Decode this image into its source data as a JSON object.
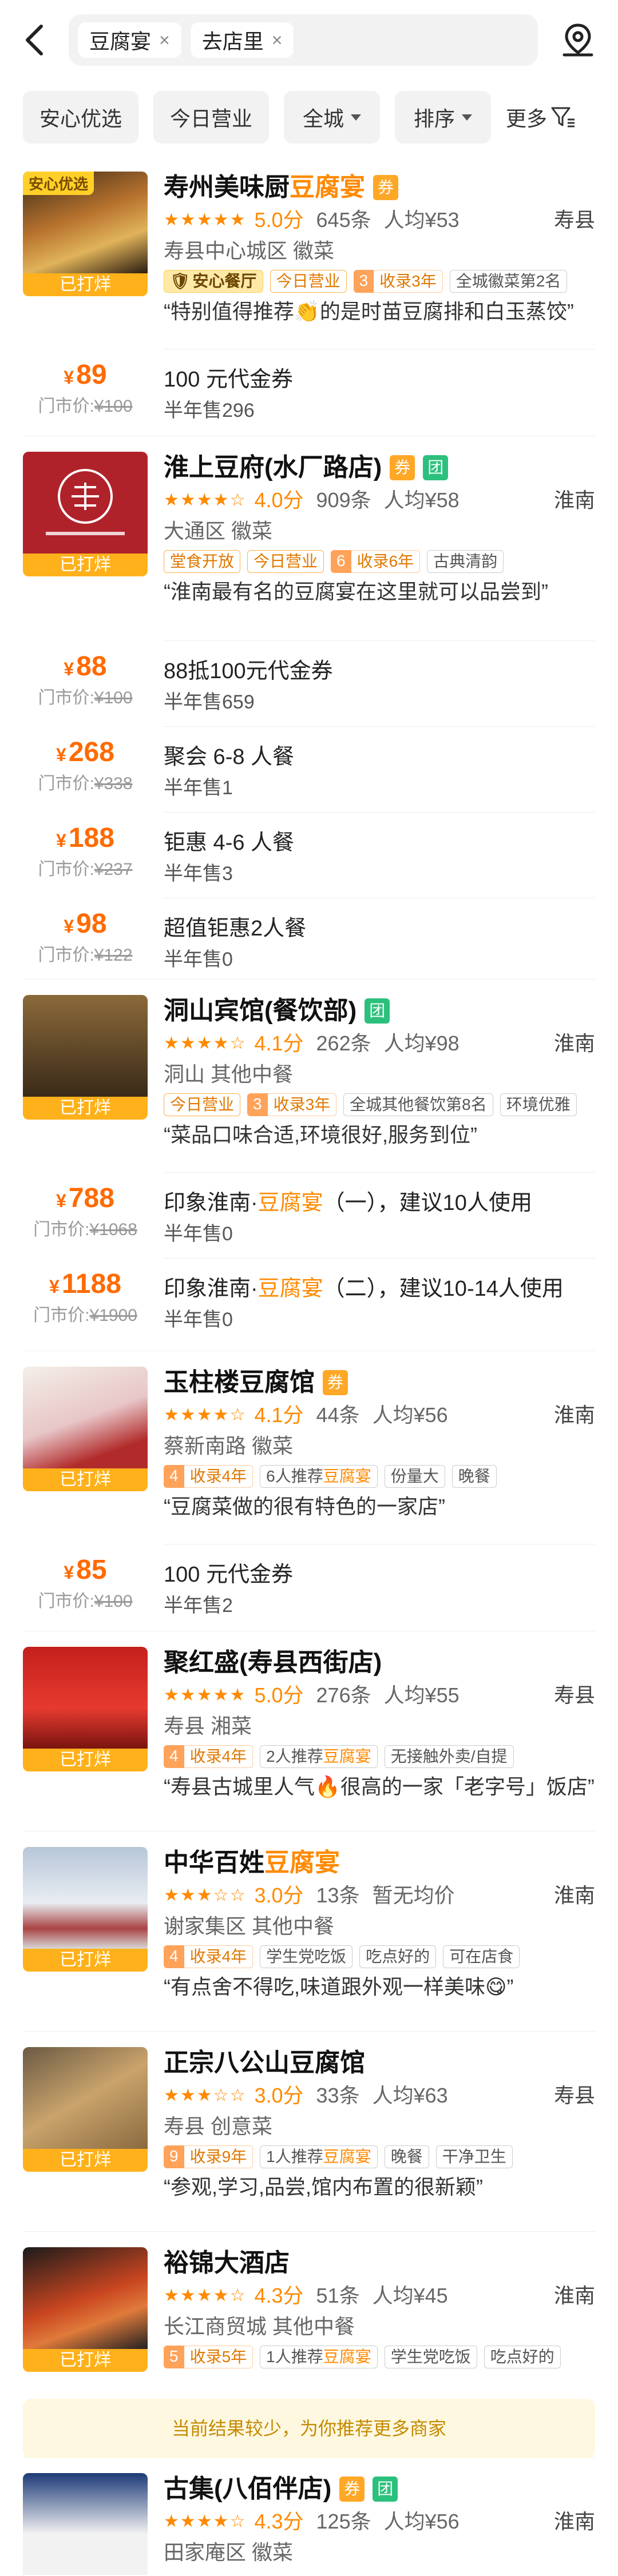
{
  "search": {
    "chips": [
      "豆腐宴",
      "去店里"
    ],
    "clear_glyph": "×"
  },
  "filters": [
    "安心优选",
    "今日营业",
    "全城",
    "排序"
  ],
  "more_label": "更多",
  "shops": [
    {
      "name_pre": "寿州美味厨",
      "name_hl": "豆腐宴",
      "name_post": "",
      "quan": "券",
      "tuan": "",
      "stars": "★★★★★",
      "score": "5.0分",
      "reviews": "645条",
      "avg": "人均¥53",
      "city": "寿县",
      "area": "寿县中心城区  徽菜",
      "badge": "安心优选",
      "tags": [
        {
          "type": "safe",
          "text": "安心餐厅"
        },
        {
          "type": "org",
          "text": "今日营业"
        },
        {
          "type": "rank",
          "n": "3",
          "l": "收录3年"
        },
        {
          "type": "plain",
          "text": "全城徽菜第2名"
        }
      ],
      "quote": "“特别值得推荐👏的是时苗豆腐排和白玉蒸饺”",
      "bar": "已打烊",
      "deals": [
        {
          "price": "89",
          "orig": "¥100",
          "title": "100 元代金券",
          "sold": "半年售296"
        }
      ]
    },
    {
      "name_pre": "淮上豆府(水厂路店)",
      "name_hl": "",
      "name_post": "",
      "quan": "券",
      "tuan": "团",
      "stars": "★★★★☆",
      "score": "4.0分",
      "reviews": "909条",
      "avg": "人均¥58",
      "city": "淮南",
      "area": "大通区  徽菜",
      "badge": "",
      "tags": [
        {
          "type": "org",
          "text": "堂食开放"
        },
        {
          "type": "org",
          "text": "今日营业"
        },
        {
          "type": "rank",
          "n": "6",
          "l": "收录6年"
        },
        {
          "type": "plain",
          "text": "古典清韵"
        }
      ],
      "quote": "“淮南最有名的豆腐宴在这里就可以品尝到”",
      "bar": "已打烊",
      "deals": [
        {
          "price": "88",
          "orig": "¥100",
          "title": "88抵100元代金券",
          "sold": "半年售659"
        },
        {
          "price": "268",
          "orig": "¥338",
          "title": "聚会 6-8 人餐",
          "sold": "半年售1"
        },
        {
          "price": "188",
          "orig": "¥237",
          "title": "钜惠 4-6 人餐",
          "sold": "半年售3"
        },
        {
          "price": "98",
          "orig": "¥122",
          "title": "超值钜惠2人餐",
          "sold": "半年售0"
        }
      ]
    },
    {
      "name_pre": "洞山宾馆(餐饮部)",
      "name_hl": "",
      "name_post": "",
      "quan": "",
      "tuan": "团",
      "stars": "★★★★☆",
      "score": "4.1分",
      "reviews": "262条",
      "avg": "人均¥98",
      "city": "淮南",
      "area": "洞山  其他中餐",
      "badge": "",
      "tags": [
        {
          "type": "org",
          "text": "今日营业"
        },
        {
          "type": "rank",
          "n": "3",
          "l": "收录3年"
        },
        {
          "type": "plain",
          "text": "全城其他餐饮第8名"
        },
        {
          "type": "plain",
          "text": "环境优雅"
        }
      ],
      "quote": "“菜品口味合适,环境很好,服务到位”",
      "bar": "已打烊",
      "deals": [
        {
          "price": "788",
          "orig": "¥1068",
          "title": "印象淮南·豆腐宴（一），建议10人使用",
          "sold": "半年售0"
        },
        {
          "price": "1188",
          "orig": "¥1900",
          "title": "印象淮南·豆腐宴（二），建议10-14人使用",
          "sold": "半年售0"
        }
      ]
    },
    {
      "name_pre": "玉柱楼豆腐馆",
      "name_hl": "",
      "name_post": "",
      "quan": "券",
      "tuan": "",
      "stars": "★★★★☆",
      "score": "4.1分",
      "reviews": "44条",
      "avg": "人均¥56",
      "city": "淮南",
      "area": "蔡新南路  徽菜",
      "badge": "",
      "tags": [
        {
          "type": "rank",
          "n": "4",
          "l": "收录4年"
        },
        {
          "type": "plain",
          "text": "6人推荐豆腐宴"
        },
        {
          "type": "plain",
          "text": "份量大"
        },
        {
          "type": "plain",
          "text": "晚餐"
        }
      ],
      "quote": "“豆腐菜做的很有特色的一家店”",
      "bar": "已打烊",
      "deals": [
        {
          "price": "85",
          "orig": "¥100",
          "title": "100 元代金券",
          "sold": "半年售2"
        }
      ]
    },
    {
      "name_pre": "聚红盛(寿县西街店)",
      "name_hl": "",
      "name_post": "",
      "quan": "",
      "tuan": "",
      "stars": "★★★★★",
      "score": "5.0分",
      "reviews": "276条",
      "avg": "人均¥55",
      "city": "寿县",
      "area": "寿县  湘菜",
      "badge": "",
      "tags": [
        {
          "type": "rank",
          "n": "4",
          "l": "收录4年"
        },
        {
          "type": "plain",
          "text": "2人推荐豆腐宴"
        },
        {
          "type": "plain",
          "text": "无接触外卖/自提"
        }
      ],
      "quote": "“寿县古城里人气🔥很高的一家「老字号」饭店”",
      "bar": "已打烊",
      "deals": []
    },
    {
      "name_pre": "中华百姓",
      "name_hl": "豆腐宴",
      "name_post": "",
      "quan": "",
      "tuan": "",
      "stars": "★★★☆☆",
      "score": "3.0分",
      "reviews": "13条",
      "avg": "暂无均价",
      "city": "淮南",
      "area": "谢家集区  其他中餐",
      "badge": "",
      "tags": [
        {
          "type": "rank",
          "n": "4",
          "l": "收录4年"
        },
        {
          "type": "plain",
          "text": "学生党吃饭"
        },
        {
          "type": "plain",
          "text": "吃点好的"
        },
        {
          "type": "plain",
          "text": "可在店食"
        }
      ],
      "quote": "“有点舍不得吃,味道跟外观一样美味😋”",
      "bar": "已打烊",
      "deals": []
    },
    {
      "name_pre": "正宗八公山豆腐馆",
      "name_hl": "",
      "name_post": "",
      "quan": "",
      "tuan": "",
      "stars": "★★★☆☆",
      "score": "3.0分",
      "reviews": "33条",
      "avg": "人均¥63",
      "city": "寿县",
      "area": "寿县  创意菜",
      "badge": "",
      "tags": [
        {
          "type": "rank",
          "n": "9",
          "l": "收录9年"
        },
        {
          "type": "plain",
          "text": "1人推荐豆腐宴"
        },
        {
          "type": "plain",
          "text": "晚餐"
        },
        {
          "type": "plain",
          "text": "干净卫生"
        }
      ],
      "quote": "“参观,学习,品尝,馆内布置的很新颖”",
      "bar": "已打烊",
      "deals": []
    },
    {
      "name_pre": "裕锦大酒店",
      "name_hl": "",
      "name_post": "",
      "quan": "",
      "tuan": "",
      "stars": "★★★★☆",
      "score": "4.3分",
      "reviews": "51条",
      "avg": "人均¥45",
      "city": "淮南",
      "area": "长江商贸城  其他中餐",
      "badge": "",
      "tags": [
        {
          "type": "rank",
          "n": "5",
          "l": "收录5年"
        },
        {
          "type": "plain",
          "text": "1人推荐豆腐宴"
        },
        {
          "type": "plain",
          "text": "学生党吃饭"
        },
        {
          "type": "plain",
          "text": "吃点好的"
        }
      ],
      "quote": "",
      "bar": "已打烊",
      "deals": []
    },
    {
      "name_pre": "古集(八佰伴店)",
      "name_hl": "",
      "name_post": "",
      "quan": "券",
      "tuan": "团",
      "stars": "★★★★☆",
      "score": "4.3分",
      "reviews": "125条",
      "avg": "人均¥56",
      "city": "淮南",
      "area": "田家庵区  徽菜",
      "badge": "",
      "tags": [],
      "quote": "",
      "bar": "",
      "deals": []
    }
  ],
  "market_price_label": "门市价:",
  "yen": "¥",
  "notice": "当前结果较少，为你推荐更多商家"
}
